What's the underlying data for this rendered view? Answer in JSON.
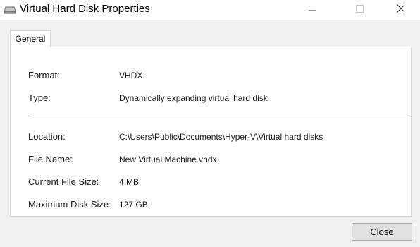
{
  "window": {
    "title": "Virtual Hard Disk Properties",
    "icon": "hard-disk-icon",
    "controls": [
      "minimize-icon",
      "maximize-icon",
      "close-icon"
    ]
  },
  "tabs": [
    {
      "label": "General",
      "selected": true
    }
  ],
  "properties": {
    "format": {
      "label": "Format:",
      "value": "VHDX"
    },
    "type": {
      "label": "Type:",
      "value": "Dynamically expanding virtual hard disk"
    },
    "location": {
      "label": "Location:",
      "value": "C:\\Users\\Public\\Documents\\Hyper-V\\Virtual hard disks"
    },
    "file_name": {
      "label": "File Name:",
      "value": "New Virtual Machine.vhdx"
    },
    "current_size": {
      "label": "Current File Size:",
      "value": "4 MB"
    },
    "max_size": {
      "label": "Maximum Disk Size:",
      "value": "127 GB"
    }
  },
  "buttons": {
    "close_label": "Close"
  },
  "colors": {
    "dialog_background": "#f0f0f0",
    "panel_background": "#ffffff",
    "button_background": "#e1e1e1"
  }
}
